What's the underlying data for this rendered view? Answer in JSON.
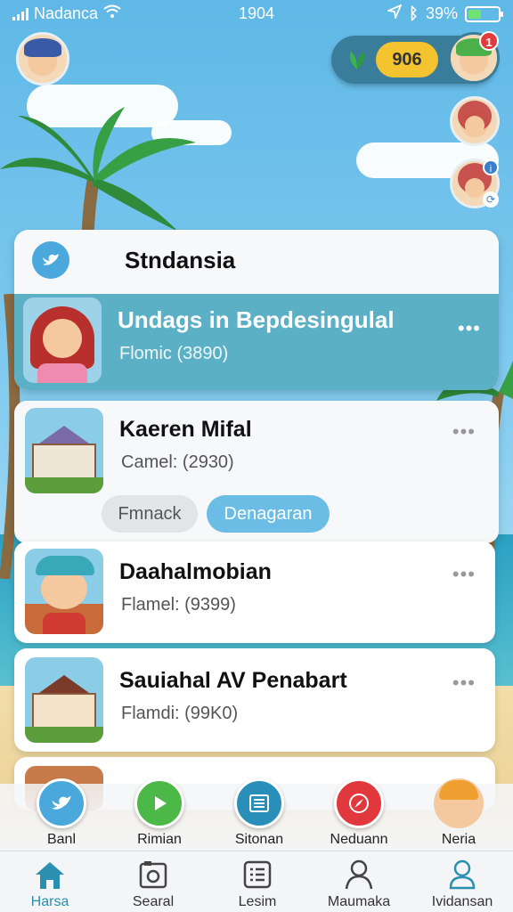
{
  "status_bar": {
    "carrier": "Nadanca",
    "time": "1904",
    "battery": "39%"
  },
  "top_bar": {
    "coins": "906",
    "notification_count": "1"
  },
  "panel": {
    "title": "Stndansia"
  },
  "items": [
    {
      "title": "Undags in Bepdesingulal",
      "subtitle": "Flomic  (3890)",
      "highlighted": true
    },
    {
      "title": "Kaeren Mifal",
      "subtitle": "Camel: (2930)"
    },
    {
      "title": "Daahalmobian",
      "subtitle": "Flamel: (9399)"
    },
    {
      "title": "Sauiahal AV Penabart",
      "subtitle": "Flamdi: (99K0)"
    }
  ],
  "more_glyph": "•••",
  "chips": {
    "secondary": "Fmnack",
    "primary": "Denagaran"
  },
  "shortcuts": [
    {
      "label": "Banl",
      "icon": "bird-icon"
    },
    {
      "label": "Rimian",
      "icon": "play-icon"
    },
    {
      "label": "Sitonan",
      "icon": "list-icon"
    },
    {
      "label": "Neduann",
      "icon": "compass-icon"
    },
    {
      "label": "Neria",
      "icon": "avatar-icon"
    }
  ],
  "tabs": [
    {
      "label": "Harsa",
      "icon": "home-icon",
      "active": true
    },
    {
      "label": "Searal",
      "icon": "camera-icon"
    },
    {
      "label": "Lesim",
      "icon": "grid-list-icon"
    },
    {
      "label": "Maumaka",
      "icon": "person-icon"
    },
    {
      "label": "Ividansan",
      "icon": "profile-icon"
    }
  ],
  "colors": {
    "accent": "#5bb0c6",
    "chip_primary": "#6cbde6",
    "coin": "#f4c330",
    "badge": "#e23b3b"
  }
}
